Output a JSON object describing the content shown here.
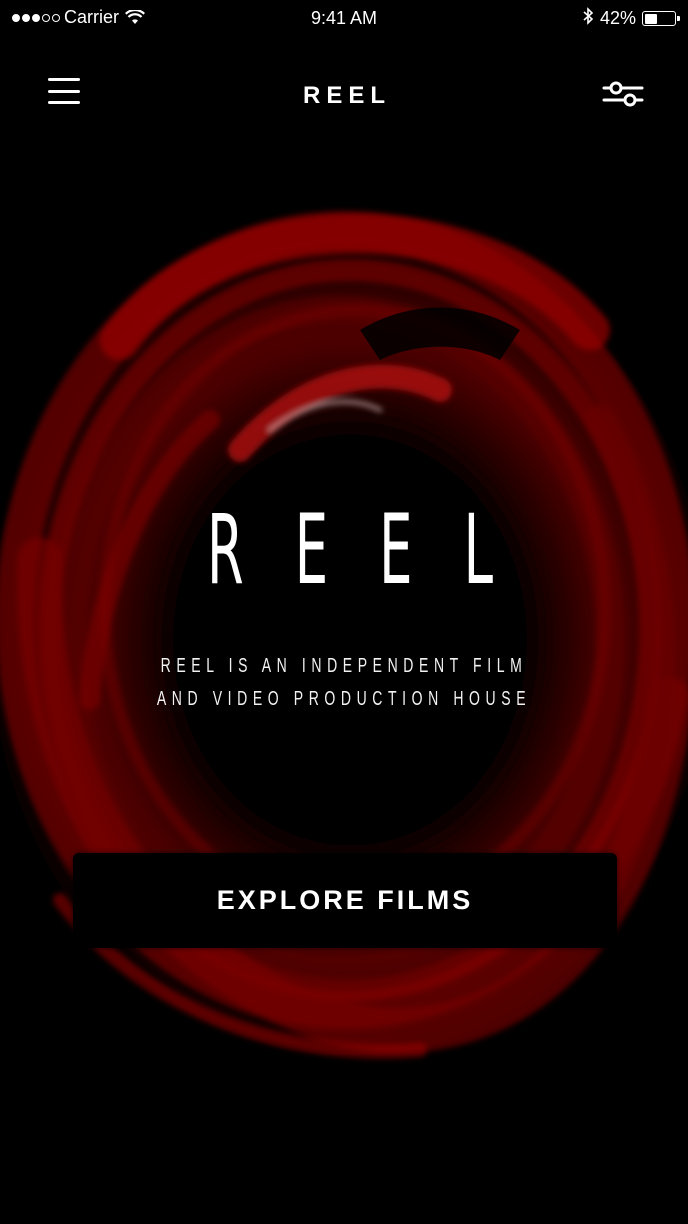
{
  "status_bar": {
    "carrier": "Carrier",
    "time": "9:41 AM",
    "battery_percent": "42%",
    "battery_level": 0.42,
    "signal_bars_on": 3,
    "signal_bars_total": 5
  },
  "nav": {
    "title": "REEL",
    "menu_icon": "hamburger-menu-icon",
    "filter_icon": "sliders-filter-icon"
  },
  "hero": {
    "wordmark": "REEL",
    "tagline_line1": "REEL IS AN INDEPENDENT FILM",
    "tagline_line2": "AND VIDEO PRODUCTION HOUSE",
    "accent_color": "#8a0000"
  },
  "cta": {
    "label": "EXPLORE FILMS"
  }
}
